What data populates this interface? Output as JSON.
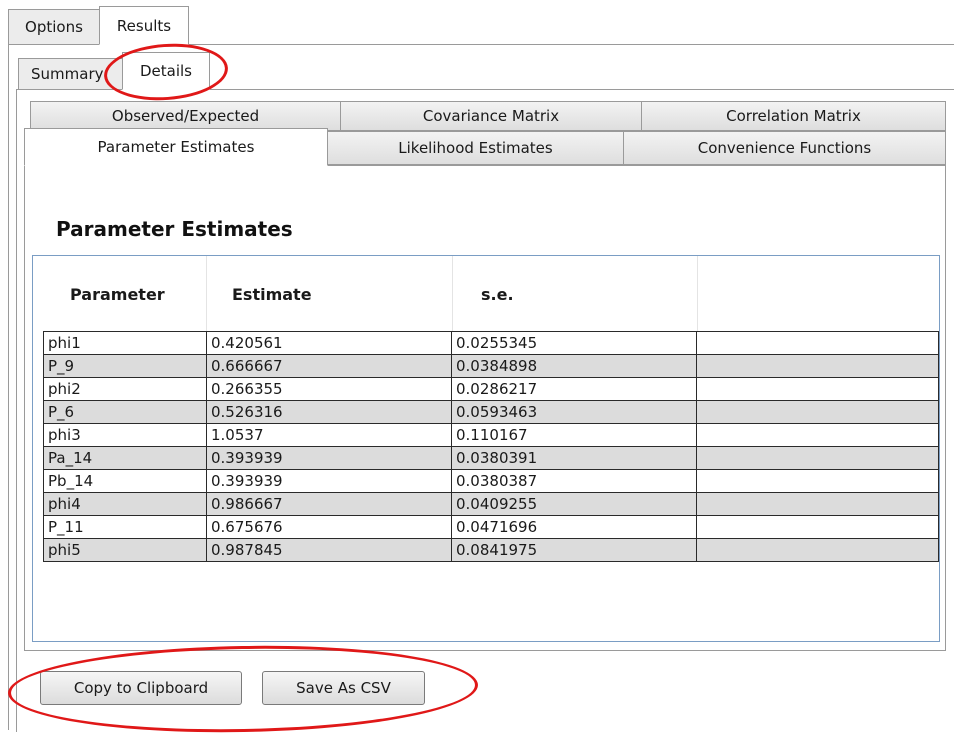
{
  "top_tabs": [
    "Options",
    "Results"
  ],
  "sub_tabs": [
    "Summary",
    "Details"
  ],
  "detail_tabs_row1": [
    "Observed/Expected",
    "Covariance Matrix",
    "Correlation Matrix"
  ],
  "detail_tabs_row2": [
    "Parameter Estimates",
    "Likelihood Estimates",
    "Convenience Functions"
  ],
  "section_title": "Parameter Estimates",
  "table": {
    "headers": [
      "Parameter",
      "Estimate",
      "s.e.",
      ""
    ],
    "rows": [
      [
        "phi1",
        "0.420561",
        "0.0255345",
        ""
      ],
      [
        "P_9",
        "0.666667",
        "0.0384898",
        ""
      ],
      [
        "phi2",
        "0.266355",
        "0.0286217",
        ""
      ],
      [
        "P_6",
        "0.526316",
        "0.0593463",
        ""
      ],
      [
        "phi3",
        "1.0537",
        "0.110167",
        ""
      ],
      [
        "Pa_14",
        "0.393939",
        "0.0380391",
        ""
      ],
      [
        "Pb_14",
        "0.393939",
        "0.0380387",
        ""
      ],
      [
        "phi4",
        "0.986667",
        "0.0409255",
        ""
      ],
      [
        "P_11",
        "0.675676",
        "0.0471696",
        ""
      ],
      [
        "phi5",
        "0.987845",
        "0.0841975",
        ""
      ]
    ]
  },
  "buttons": {
    "copy": "Copy to Clipboard",
    "csv": "Save As CSV"
  },
  "colors": {
    "annotation": "#e01818",
    "row_alt": "#dcdcdc",
    "grid_border": "#7a9dc4"
  }
}
